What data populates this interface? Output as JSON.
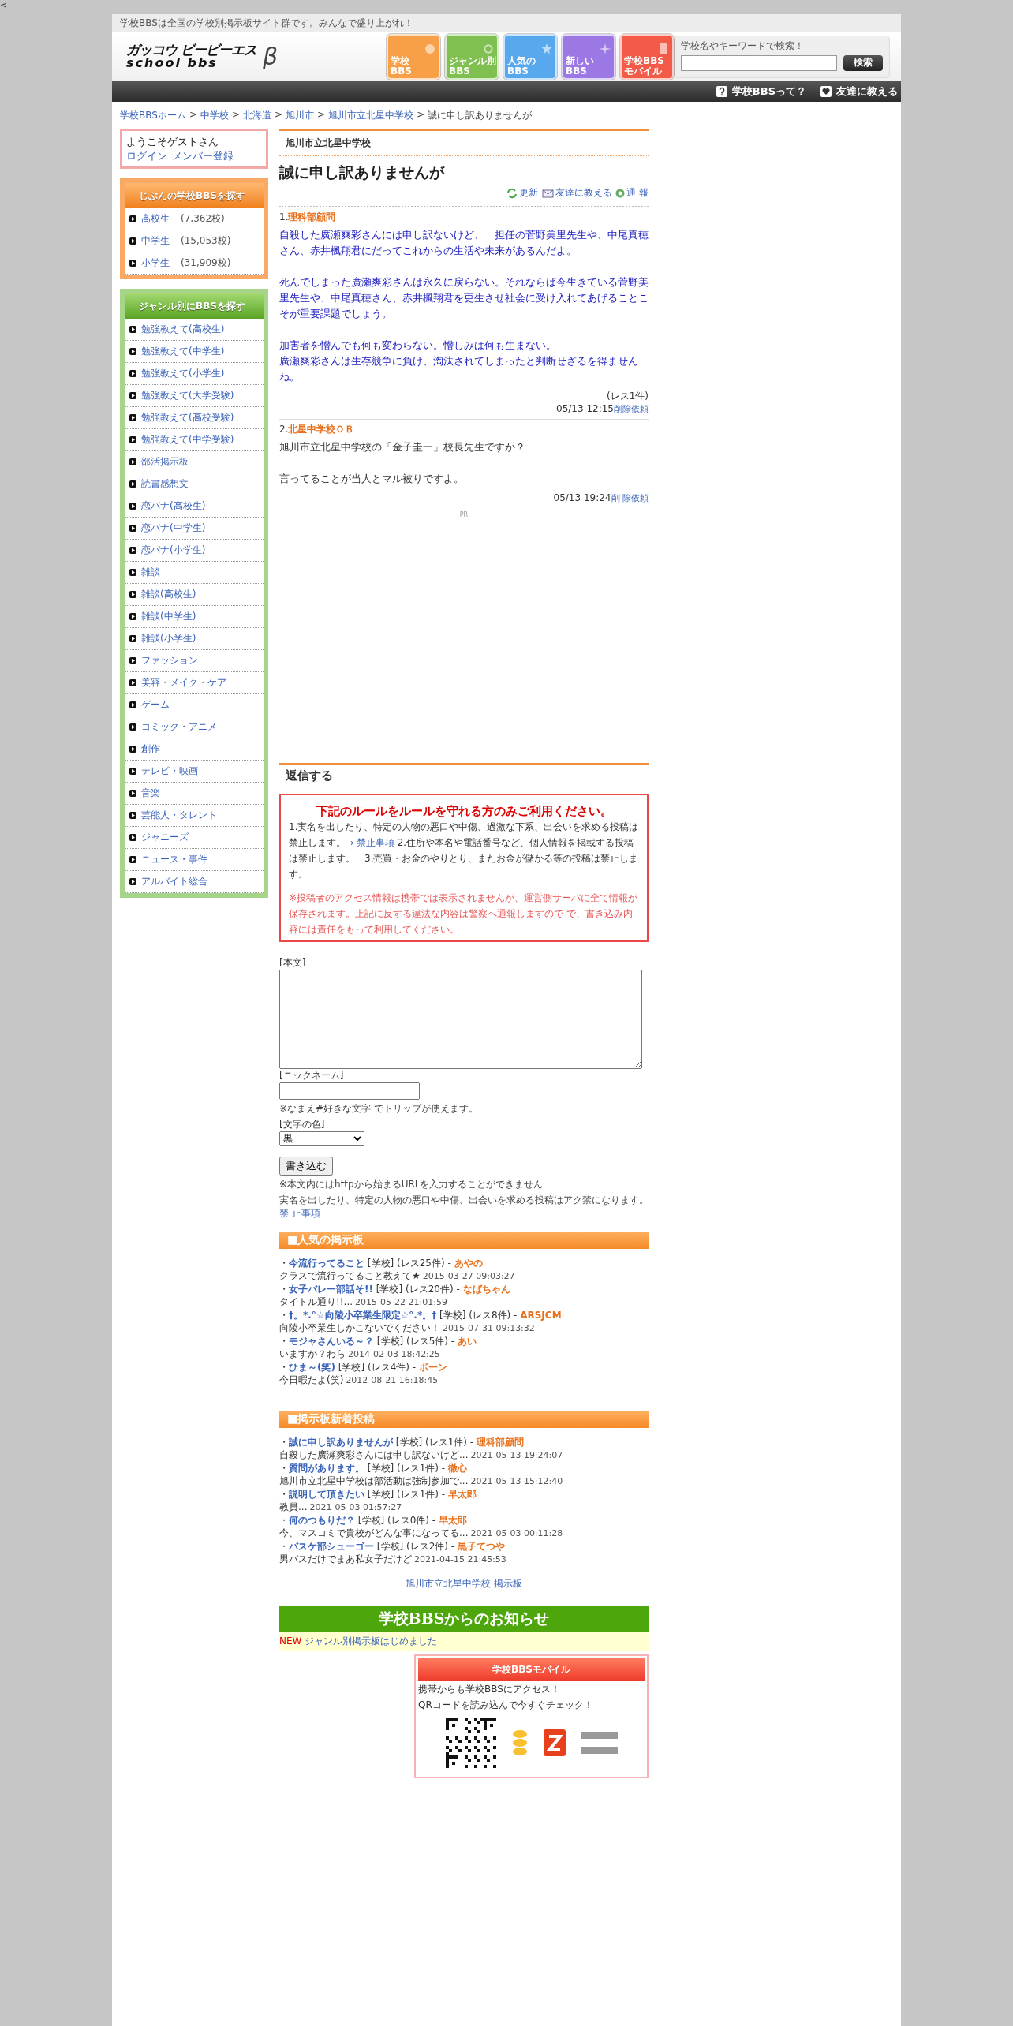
{
  "corner_mark": "<",
  "top_notice": "学校BBSは全国の学校別掲示板サイト群です。みんなで盛り上がれ！",
  "logo": {
    "line1": "ガッコウ ビービーエス",
    "line2": "school bbs",
    "mark": "β"
  },
  "nav_tiles": [
    {
      "lines": [
        "学校",
        "BBS"
      ],
      "color": "#f7a048"
    },
    {
      "lines": [
        "ジャンル別",
        "BBS"
      ],
      "color": "#80c050"
    },
    {
      "lines": [
        "人気の",
        "BBS"
      ],
      "color": "#58a8ee"
    },
    {
      "lines": [
        "新しい",
        "BBS"
      ],
      "color": "#9c78e4"
    },
    {
      "lines": [
        "学校BBS",
        "モバイル"
      ],
      "color": "#f45a48"
    }
  ],
  "search": {
    "caption": "学校名やキーワードで検索！",
    "button": "検索"
  },
  "top_links": [
    {
      "kind": "question",
      "label": "学校BBSって？"
    },
    {
      "kind": "heart",
      "label": "友達に教える"
    }
  ],
  "breadcrumb": {
    "links": [
      "学校BBSホーム",
      "中学校",
      "北海道",
      "旭川市",
      "旭川市立北星中学校"
    ],
    "sep": ">",
    "current": "誠に申し訳ありませんが"
  },
  "sidebar": {
    "welcome": {
      "greeting": "ようこそゲストさん",
      "links": [
        "ログイン",
        "メンバー登録"
      ]
    },
    "school_search": {
      "title": "じぶんの学校BBSを探す",
      "items": [
        {
          "label": "高校生",
          "count": "(7,362校)"
        },
        {
          "label": "中学生",
          "count": "(15,053校)"
        },
        {
          "label": "小学生",
          "count": "(31,909校)"
        }
      ]
    },
    "genre_search": {
      "title": "ジャンル別にBBSを探す",
      "items": [
        "勉強教えて(高校生)",
        "勉強教えて(中学生)",
        "勉強教えて(小学生)",
        "勉強教えて(大学受験)",
        "勉強教えて(高校受験)",
        "勉強教えて(中学受験)",
        "部活掲示板",
        "読書感想文",
        "恋バナ(高校生)",
        "恋バナ(中学生)",
        "恋バナ(小学生)",
        "雑談",
        "雑談(高校生)",
        "雑談(中学生)",
        "雑談(小学生)",
        "ファッション",
        "美容・メイク・ケア",
        "ゲーム",
        "コミック・アニメ",
        "創作",
        "テレビ・映画",
        "音楽",
        "芸能人・タレント",
        "ジャニーズ",
        "ニュース・事件",
        "アルバイト総合"
      ]
    }
  },
  "thread": {
    "school": "旭川市立北星中学校",
    "title": "誠に申し訳ありませんが",
    "actions": [
      {
        "kind": "refresh",
        "label": "更新"
      },
      {
        "kind": "mail",
        "label": "友達に教える"
      },
      {
        "kind": "report",
        "label": "通 報"
      }
    ],
    "posts": [
      {
        "number": "1.",
        "author": "理科部顧問",
        "color": "#2020c0",
        "paragraphs": [
          [
            "自殺した廣瀬爽彩さんには申し訳ないけど、　担任の菅野美里先生や、中尾真穂さん、赤井楓翔君にだってこれからの生活や未来があるんだよ。"
          ],
          [
            "死んでしまった廣瀬爽彩さんは永久に戻らない。それならば今生きている菅野美里先生や、中尾真穂さん、赤井楓翔君を更生させ社会に受け入れてあげることこそが重要課題でしょう。"
          ],
          [
            "加害者を憎んでも何も変わらない。憎しみは何も生まない。",
            "廣瀬爽彩さんは生存競争に負け、淘汰されてしまったと判断せざるを得ませんね。"
          ]
        ],
        "replies": "(レス1件)",
        "date": "05/13 12:15",
        "delete": "削除依頼"
      },
      {
        "number": "2.",
        "author": "北星中学校ＯＢ",
        "color": "#333333",
        "paragraphs": [
          [
            "旭川市立北星中学校の「金子圭一」校長先生ですか？"
          ],
          [
            "言ってることが当人とマル被りですよ。"
          ]
        ],
        "date": "05/13 19:24",
        "delete": "削 除依頼"
      }
    ],
    "pr": "PR"
  },
  "reply": {
    "title": "返信する",
    "rules": {
      "heading": "下記のルールをルールを守れる方のみご利用ください。",
      "before": "1.実名を出したり、特定の人物の悪口や中傷、過激な下系、出会いを求める投稿は禁止します。",
      "link": "→ 禁止事項",
      "after": " 2.住所や本名や電話番号など、個人情報を掲載する投稿は禁止します。　3.売買・お金のやりとり、またお金が儲かる等の投稿は禁止します。",
      "warning": "※投稿者のアクセス情報は携帯では表示されませんが、運営側サーバに全て情報が保存されます。上記に反する違法な内容は警察へ通報しますので で、書き込み内容には責任をもって利用してください。"
    },
    "body_label": "[本文]",
    "nickname_label": "[ニックネーム]",
    "nickname_note": "※なまえ#好きな文字 でトリップが使えます。",
    "color_label": "[文字の色]",
    "color_value": "黒",
    "submit": "書き込む",
    "url_note": "※本文内にはhttpから始まるURLを入力することができません",
    "ban_note": "実名を出したり、特定の人物の悪口や中傷、出会いを求める投稿はアク禁になります。",
    "ban_link": "禁 止事項"
  },
  "popular": {
    "title": "■人気の掲示板",
    "bullet": "・",
    "items": [
      {
        "title": "今流行ってること",
        "tag": "[学校]",
        "replies": "(レス25件) -",
        "author": "あやの",
        "excerpt": "クラスで流行ってること教えて★",
        "date": "2015-03-27 09:03:27"
      },
      {
        "title": "女子バレー部話そ!!",
        "tag": "[学校]",
        "replies": "(レス20件) -",
        "author": "なばちゃん",
        "excerpt": "タイトル通り!!...",
        "date": "2015-05-22 21:01:59"
      },
      {
        "title": "†。*.°☆向陵小卒業生限定☆°.*。†",
        "tag": "[学校]",
        "replies": "(レス8件) -",
        "author": "ARSJCM",
        "excerpt": "向陵小卒業生しかこないでください！",
        "date": "2015-07-31 09:13:32"
      },
      {
        "title": "モジャさんいる～？",
        "tag": "[学校]",
        "replies": "(レス5件) -",
        "author": "あい",
        "excerpt": "いますか？わら",
        "date": "2014-02-03 18:42:25"
      },
      {
        "title": "ひま～(笑)",
        "tag": "[学校]",
        "replies": "(レス4件) -",
        "author": "ボーン",
        "excerpt": "今日暇だよ(笑)",
        "date": "2012-08-21 16:18:45"
      }
    ]
  },
  "new_posts": {
    "title": "■掲示板新着投稿",
    "bullet": "・",
    "items": [
      {
        "title": "誠に申し訳ありませんが",
        "tag": "[学校]",
        "replies": "(レス1件) -",
        "author": "理科部顧問",
        "excerpt": "自殺した廣瀬爽彩さんには申し訳ないけど...",
        "date": "2021-05-13 19:24:07"
      },
      {
        "title": "質問があります。",
        "tag": "[学校]",
        "replies": "(レス1件) -",
        "author": "徹心",
        "excerpt": "旭川市立北星中学校は部活動は強制参加で...",
        "date": "2021-05-13 15:12:40"
      },
      {
        "title": "説明して頂きたい",
        "tag": "[学校]",
        "replies": "(レス1件) -",
        "author": "早太郎",
        "excerpt": "教員...",
        "date": "2021-05-03 01:57:27"
      },
      {
        "title": "何のつもりだ？",
        "tag": "[学校]",
        "replies": "(レス0件) -",
        "author": "早太郎",
        "excerpt": "今、マスコミで貴校がどんな事になってる...",
        "date": "2021-05-03 00:11:28"
      },
      {
        "title": "バスケ部シューゴー",
        "tag": "[学校]",
        "replies": "(レス2件) -",
        "author": "黒子てつや",
        "excerpt": "男バスだけでまあ私女子だけど",
        "date": "2021-04-15 21:45:53"
      }
    ]
  },
  "board_link": "旭川市立北星中学校 掲示板",
  "notice": {
    "title": "学校BBSからのお知らせ",
    "items": [
      {
        "badge": "NEW",
        "text": "ジャンル別掲示板はじめました"
      }
    ]
  },
  "mobile": {
    "title": "学校BBSモバイル",
    "lines": [
      "携帯からも学校BBSにアクセス！",
      "QRコードを読み込んで今すぐチェック！"
    ]
  }
}
